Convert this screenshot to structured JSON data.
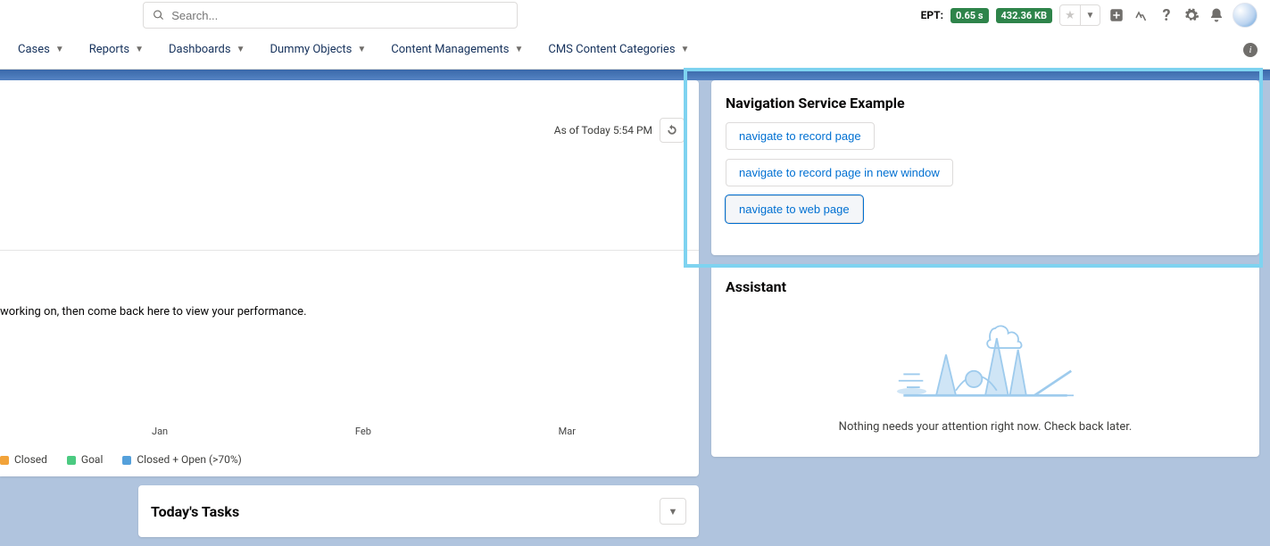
{
  "header": {
    "search_placeholder": "Search...",
    "ept_label": "EPT:",
    "ept_time": "0.65 s",
    "ept_size": "432.36 KB"
  },
  "nav": {
    "items": [
      {
        "label": "Cases"
      },
      {
        "label": "Reports"
      },
      {
        "label": "Dashboards"
      },
      {
        "label": "Dummy Objects"
      },
      {
        "label": "Content Managements"
      },
      {
        "label": "CMS Content Categories"
      }
    ]
  },
  "left_card": {
    "status_text": "As of Today 5:54 PM",
    "perf_text": "working on, then come back here to view your performance.",
    "months": [
      "Jan",
      "Feb",
      "Mar"
    ],
    "legend": [
      {
        "label": "Closed",
        "color": "#f2a33a"
      },
      {
        "label": "Goal",
        "color": "#4bca81"
      },
      {
        "label": "Closed + Open (>70%)",
        "color": "#54a0db"
      }
    ]
  },
  "tasks": {
    "title": "Today's Tasks"
  },
  "nav_example": {
    "title": "Navigation Service Example",
    "buttons": [
      {
        "label": "navigate to record page"
      },
      {
        "label": "navigate to record page in new window"
      },
      {
        "label": "navigate to web page"
      }
    ]
  },
  "assistant": {
    "title": "Assistant",
    "empty_text": "Nothing needs your attention right now. Check back later."
  }
}
